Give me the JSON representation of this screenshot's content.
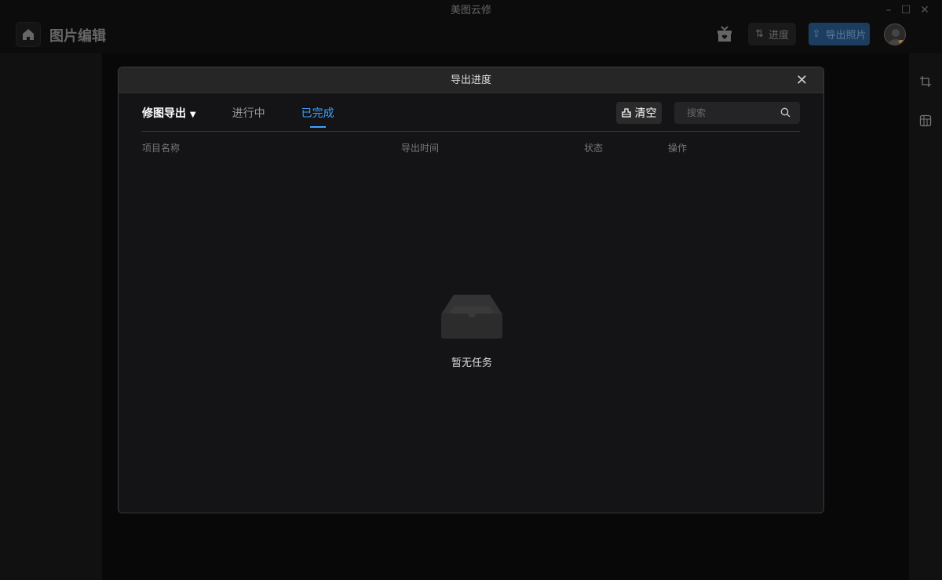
{
  "window": {
    "title": "美图云修"
  },
  "topbar": {
    "app_title": "图片编辑",
    "progress_label": "进度",
    "export_label": "导出照片"
  },
  "dialog": {
    "title": "导出进度",
    "tabs": [
      {
        "label": "修图导出"
      },
      {
        "label": "进行中"
      },
      {
        "label": "已完成"
      }
    ],
    "active_tab": "已完成",
    "clear_label": "清空",
    "search": {
      "placeholder": "搜索",
      "value": ""
    },
    "columns": [
      "项目名称",
      "导出时间",
      "状态",
      "操作"
    ],
    "empty_text": "暂无任务"
  },
  "colors": {
    "accent": "#3ea0ff",
    "export_button": "#1b3d60"
  }
}
